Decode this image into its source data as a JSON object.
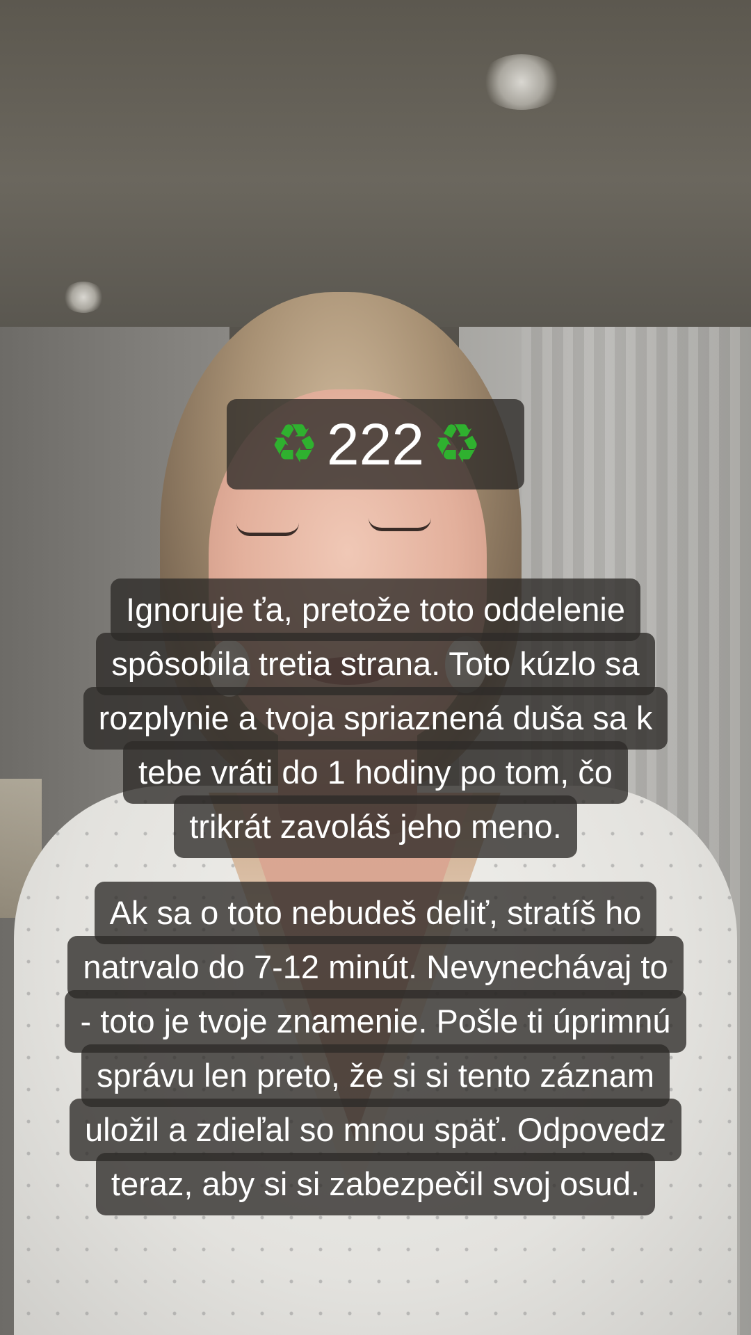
{
  "title_overlay": {
    "number": "222",
    "left_icon": "recycle-icon",
    "right_icon": "recycle-icon",
    "icon_glyph": "♻",
    "icon_color": "#2fb12f"
  },
  "caption_1": {
    "lines": [
      "Ignoruje ťa, pretože toto oddelenie",
      "spôsobila tretia strana. Toto kúzlo sa",
      "rozplynie a tvoja spriaznená duša sa k",
      "tebe vráti do 1 hodiny po tom, čo",
      "trikrát zavoláš jeho meno."
    ]
  },
  "caption_2": {
    "lines": [
      "Ak sa o toto nebudeš deliť, stratíš ho",
      "natrvalo do 7-12 minút. Nevynechávaj to",
      "- toto je tvoje znamenie. Pošle ti úprimnú",
      "správu len preto, že si si tento záznam",
      "uložil a zdieľal so mnou späť. Odpovedz",
      "teraz, aby si si zabezpečil svoj osud."
    ]
  },
  "colors": {
    "caption_bg": "rgba(45,42,40,0.78)",
    "caption_text": "#ffffff"
  }
}
